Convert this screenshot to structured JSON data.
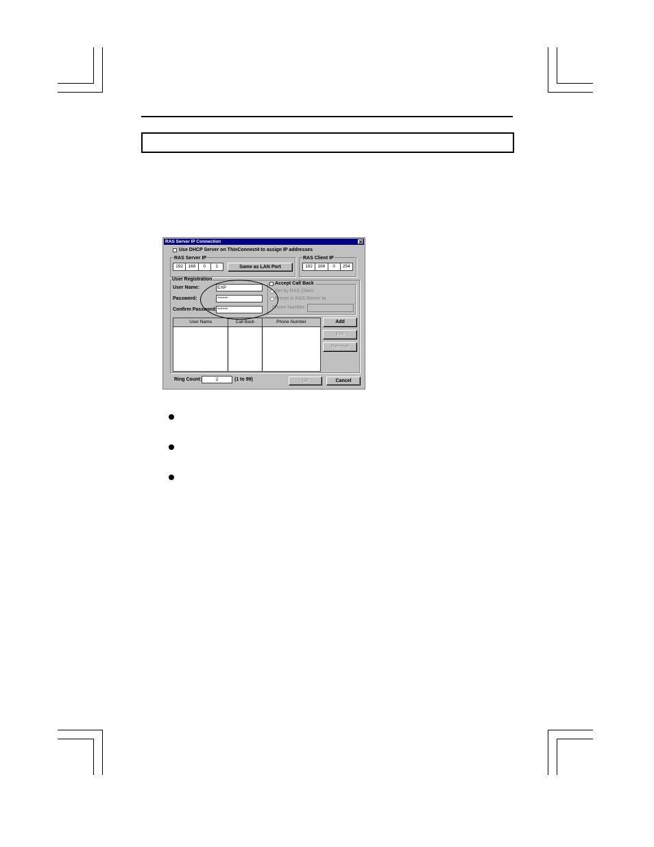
{
  "dialog": {
    "title": "RAS Server IP Connection",
    "close_glyph": "✕",
    "dhcp_label": "Use DHCP Server on ThinConnect4 to assign IP addresses",
    "server_ip": {
      "label": "RAS Server IP",
      "octets": [
        "192",
        "168",
        "0",
        "1"
      ]
    },
    "same_as_lan_label": "Same as LAN Port",
    "client_ip": {
      "label": "RAS Client IP",
      "octets": [
        "192",
        "168",
        "0",
        "254"
      ]
    },
    "registration": {
      "group_label": "User Registration",
      "user_name_label": "User Name:",
      "user_name_value": "EXP",
      "password_label": "Password:",
      "password_value": "******",
      "confirm_label": "Confirm Password:",
      "confirm_value": "******"
    },
    "callback": {
      "accept_label": "Accept Call Back",
      "set_by_client_label": "Set by RAS Client",
      "preset_label": "Preset in RAS Server to",
      "phone_label": "Phone Number:"
    },
    "table": {
      "columns": [
        "User Name",
        "Call Back",
        "Phone Number"
      ]
    },
    "buttons": {
      "add": "Add",
      "edit": "Edit",
      "remove": "Remove",
      "ok": "OK",
      "cancel": "Cancel"
    },
    "ring_count": {
      "label": "Ring Count:",
      "value": "2",
      "range": "(1 to 99)"
    }
  }
}
